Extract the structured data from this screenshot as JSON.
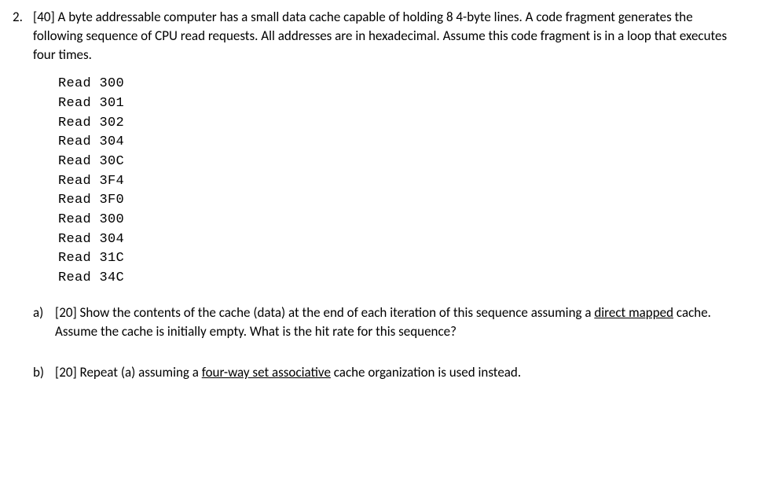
{
  "problem": {
    "number": "2.",
    "points": "[40]",
    "intro": "A byte addressable computer has a small data cache capable of holding 8 4-byte lines.  A code fragment generates the following sequence of CPU read requests.  All addresses are in hexadecimal.  Assume this code fragment is in a loop that executes four times."
  },
  "reads": [
    "Read 300",
    "Read 301",
    "Read 302",
    "Read 304",
    "Read 30C",
    "Read 3F4",
    "Read 3F0",
    "Read 300",
    "Read 304",
    "Read 31C",
    "Read 34C"
  ],
  "part_a": {
    "label": "a)",
    "points": "[20]",
    "before_u": "Show the contents of the cache (data) at the end of each iteration of this sequence assuming a ",
    "underlined": "direct mapped",
    "after_u": " cache.  Assume the cache is initially empty.   What is the hit rate for this sequence?"
  },
  "part_b": {
    "label": "b)",
    "points": "[20]",
    "before_u": "Repeat (a) assuming a ",
    "underlined": "four-way set associative",
    "after_u": " cache organization is used instead."
  }
}
